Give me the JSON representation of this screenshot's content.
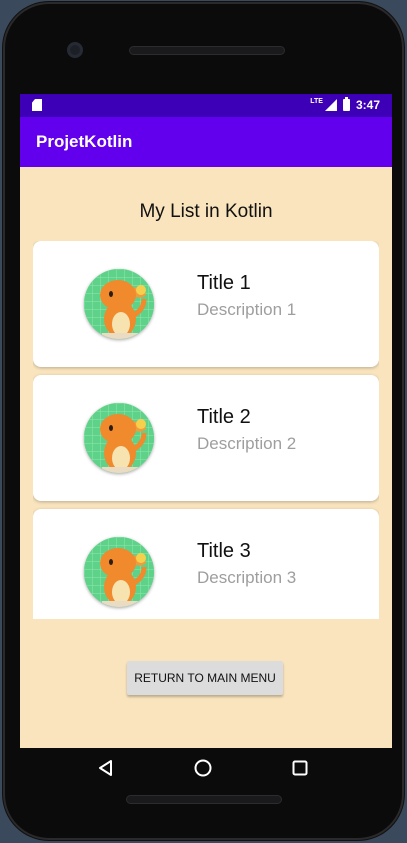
{
  "status_bar": {
    "network": "LTE",
    "time": "3:47"
  },
  "app_bar": {
    "title": "ProjetKotlin"
  },
  "list": {
    "heading": "My List in Kotlin",
    "items": [
      {
        "title": "Title 1",
        "description": "Description 1",
        "avatar": "charmander-avatar"
      },
      {
        "title": "Title 2",
        "description": "Description 2",
        "avatar": "charmander-avatar"
      },
      {
        "title": "Title 3",
        "description": "Description 3",
        "avatar": "charmander-avatar"
      }
    ]
  },
  "actions": {
    "return_label": "RETURN TO MAIN MENU"
  },
  "nav_bar": {
    "icons": [
      "back-icon",
      "home-icon",
      "recents-icon"
    ]
  },
  "colors": {
    "status_bar": "#3d00b6",
    "app_bar": "#6200ee",
    "background": "#f9e4bd",
    "card": "#ffffff",
    "description_text": "#9e9e9e"
  }
}
